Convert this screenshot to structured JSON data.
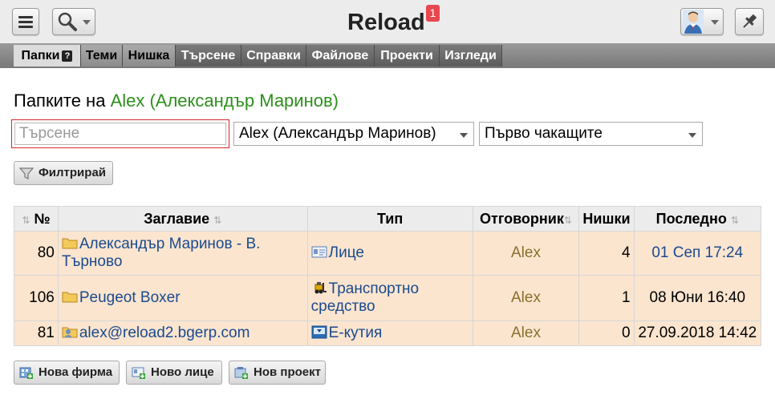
{
  "app": {
    "title": "Reload",
    "notifications": "1"
  },
  "nav": {
    "tabs": [
      {
        "label": "Папки",
        "help": "?"
      },
      {
        "label": "Теми"
      },
      {
        "label": "Нишка"
      },
      {
        "label": "Търсене"
      },
      {
        "label": "Справки"
      },
      {
        "label": "Файлове"
      },
      {
        "label": "Проекти"
      },
      {
        "label": "Изгледи"
      }
    ]
  },
  "page": {
    "title_prefix": "Папките на ",
    "title_user": "Alex (Александър Маринов)",
    "search_placeholder": "Търсене",
    "user_select": "Alex (Александър Маринов)",
    "order_select": "Първо чакащите",
    "filter_button": "Филтрирай"
  },
  "table": {
    "headers": {
      "no": "№",
      "title": "Заглавие",
      "type": "Тип",
      "responsible": "Отговорник",
      "threads": "Нишки",
      "last": "Последно"
    },
    "rows": [
      {
        "no": "80",
        "title": "Александър Маринов - В. Търново",
        "title_icon": "folder-icon",
        "type": "Лице",
        "type_icon": "id-card-icon",
        "responsible": "Alex",
        "threads": "4",
        "last": "01 Сеп 17:24",
        "last_link": true
      },
      {
        "no": "106",
        "title": "Peugeot Boxer",
        "title_icon": "folder-icon",
        "type": "Транспортно средство",
        "type_icon": "forklift-icon",
        "responsible": "Alex",
        "threads": "1",
        "last": "08 Юни 16:40",
        "last_link": false
      },
      {
        "no": "81",
        "title": "alex@reload2.bgerp.com",
        "title_icon": "user-folder-icon",
        "type": "Е-кутия",
        "type_icon": "inbox-icon",
        "responsible": "Alex",
        "threads": "0",
        "last": "27.09.2018 14:42",
        "last_link": false
      }
    ]
  },
  "actions": {
    "new_company": "Нова фирма",
    "new_person": "Ново лице",
    "new_project": "Нов проект"
  },
  "colors": {
    "user_green": "#2d8f1c",
    "link_blue": "#1a4a8e",
    "row_bg": "#fbe5cf",
    "badge_red": "#e8474f"
  }
}
